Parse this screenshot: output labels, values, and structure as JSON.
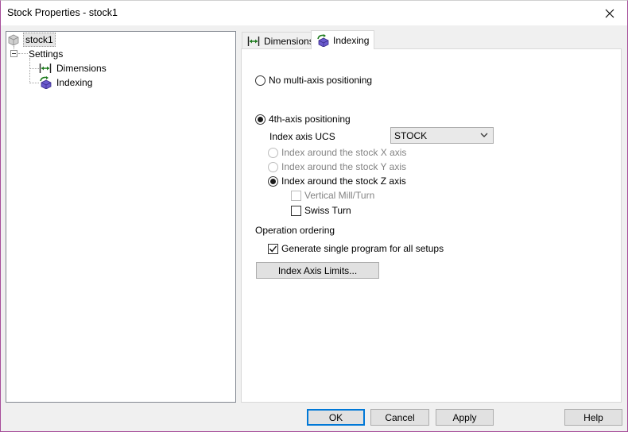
{
  "window": {
    "title": "Stock Properties - stock1"
  },
  "tree": {
    "root": "stock1",
    "settings": "Settings",
    "items": [
      "Dimensions",
      "Indexing"
    ]
  },
  "tabs": [
    {
      "label": "Dimensions",
      "icon": "dimensions-icon",
      "active": false
    },
    {
      "label": "Indexing",
      "icon": "indexing-icon",
      "active": true
    }
  ],
  "indexing": {
    "no_multi_axis": "No multi-axis positioning",
    "fourth_axis": "4th-axis positioning",
    "index_axis_ucs_label": "Index axis UCS",
    "index_axis_ucs_value": "STOCK",
    "around_x": "Index around the stock X axis",
    "around_y": "Index around the stock Y axis",
    "around_z": "Index around the stock Z axis",
    "vertical_mill_turn": "Vertical Mill/Turn",
    "swiss_turn": "Swiss Turn",
    "operation_ordering": "Operation ordering",
    "generate_single_program": "Generate single program for all setups",
    "index_axis_limits": "Index Axis Limits..."
  },
  "footer": {
    "ok": "OK",
    "cancel": "Cancel",
    "apply": "Apply",
    "help": "Help"
  },
  "colors": {
    "accent": "#0078d7",
    "icon_green": "#1e7b1e",
    "icon_purple": "#6a5acd",
    "disabled_text": "#838383"
  }
}
